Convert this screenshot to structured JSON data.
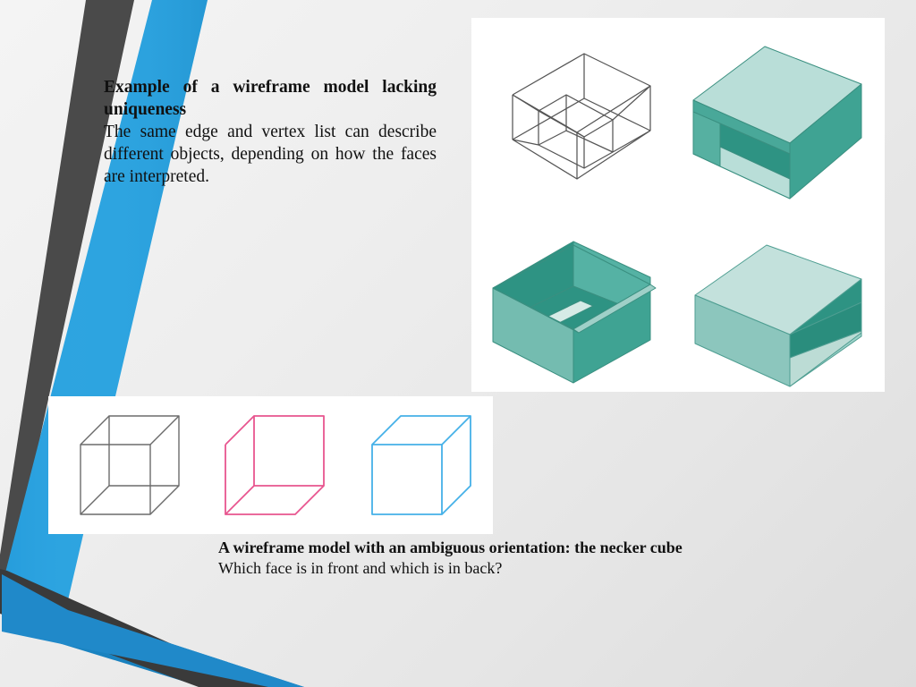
{
  "slide": {
    "title": "Example of a wireframe model lacking uniqueness",
    "background_color": "#ededed"
  },
  "decoration": {
    "name": "left-diagonal-ribbons",
    "colors": {
      "dark_gray": "#4a4a4a",
      "dark_gray_shadow": "#3a3a3a",
      "blue": "#2da4e0",
      "blue_dark": "#1b84c4"
    }
  },
  "text_top": {
    "heading": "Example of a wireframe model lacking uniqueness",
    "body": "The same edge and vertex list can describe different objects, depending on how the faces are interpreted."
  },
  "text_bottom": {
    "heading": "A wireframe model with an ambiguous orientation: the necker cube",
    "body": "Which face is in front and which is in back?"
  },
  "figure_boxes": {
    "caption_ref": "Example of a wireframe model lacking uniqueness",
    "panel_background": "#ffffff",
    "items": [
      {
        "name": "wireframe-box",
        "label": "Wireframe box with interior partition edges",
        "stroke": "#555555"
      },
      {
        "name": "solid-box-top-right",
        "label": "Solid box interpretation: closed top, open front-left pocket",
        "top_face": "#b9ded8",
        "side_face": "#3c9b8b",
        "front_face": "#3fa393"
      },
      {
        "name": "solid-box-bottom-left",
        "label": "Open tray interpretation: open top box",
        "top_face": "#b9ded8",
        "side_face": "#4aa695",
        "front_face": "#3c9b8b"
      },
      {
        "name": "solid-box-bottom-right",
        "label": "Solid box interpretation: closed top, open front shelf",
        "top_face": "#c3e1dc",
        "side_face": "#8cc6bd",
        "front_face": "#2e9383"
      }
    ]
  },
  "figure_cubes": {
    "panel_background": "#ffffff",
    "items": [
      {
        "name": "necker-cube-ambiguous",
        "label": "Necker cube - ambiguous wireframe",
        "stroke": "#6b6b6b"
      },
      {
        "name": "necker-cube-interpretation-a",
        "label": "Necker cube - interpretation A",
        "stroke": "#e8558f"
      },
      {
        "name": "necker-cube-interpretation-b",
        "label": "Necker cube - interpretation B",
        "stroke": "#45b1e8"
      }
    ]
  }
}
